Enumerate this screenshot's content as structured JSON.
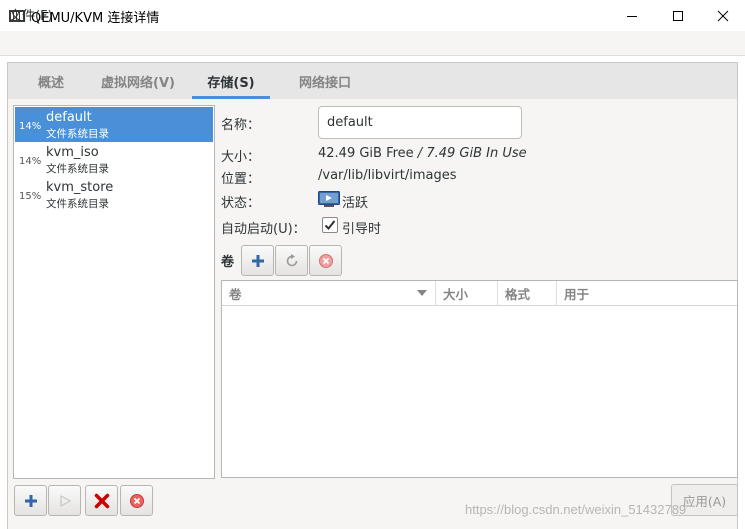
{
  "window": {
    "title": "QEMU/KVM 连接详情"
  },
  "menu": {
    "file": "文件(F)"
  },
  "tabs": [
    {
      "label": "概述"
    },
    {
      "label": "虚拟网络(V)"
    },
    {
      "label": "存储(S)"
    },
    {
      "label": "网络接口"
    }
  ],
  "pools": [
    {
      "percent": "14%",
      "name": "default",
      "type": "文件系统目录",
      "selected": true
    },
    {
      "percent": "14%",
      "name": "kvm_iso",
      "type": "文件系统目录",
      "selected": false
    },
    {
      "percent": "15%",
      "name": "kvm_store",
      "type": "文件系统目录",
      "selected": false
    }
  ],
  "details": {
    "name_label": "名称：",
    "name_value": "default",
    "size_label": "大小：",
    "size_free": "42.49 GiB Free",
    "size_sep": " / ",
    "size_in_use": "7.49 GiB In Use",
    "location_label": "位置：",
    "location_value": "/var/lib/libvirt/images",
    "state_label": "状态：",
    "state_value": "活跃",
    "autostart_label": "自动启动(U)：",
    "autostart_value": "引导时",
    "autostart_checked": true
  },
  "volumes": {
    "label": "卷",
    "columns": [
      "卷",
      "大小",
      "格式",
      "用于"
    ],
    "rows": []
  },
  "buttons": {
    "apply": "应用(A)"
  },
  "watermark": "https://blog.csdn.net/weixin_51432789",
  "colors": {
    "accent": "#4a90d9",
    "delete_red": "#cc0000",
    "add_blue": "#3465a4"
  }
}
